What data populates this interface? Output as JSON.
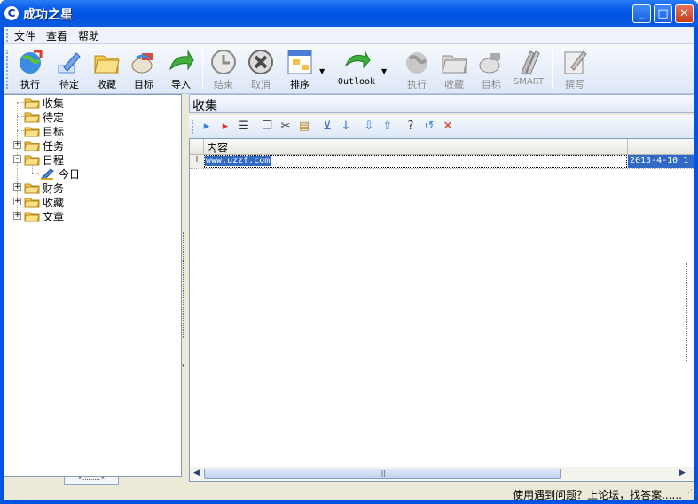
{
  "window": {
    "title": "成功之星",
    "icon_letter": "C",
    "minimize": "_",
    "maximize": "□",
    "close": "✕"
  },
  "menu": [
    "文件",
    "查看",
    "帮助"
  ],
  "toolbar": {
    "buttons": [
      {
        "label": "执行",
        "icon": "globe-run-icon",
        "enabled": true
      },
      {
        "label": "待定",
        "icon": "pencil-icon",
        "enabled": true
      },
      {
        "label": "收藏",
        "icon": "folder-icon",
        "enabled": true
      },
      {
        "label": "目标",
        "icon": "target-icon",
        "enabled": true
      },
      {
        "label": "导入",
        "icon": "import-arrow-icon",
        "enabled": true
      },
      {
        "label": "结束",
        "icon": "clock-icon",
        "enabled": false
      },
      {
        "label": "取消",
        "icon": "cancel-icon",
        "enabled": false
      },
      {
        "label": "排序",
        "icon": "sort-icon",
        "enabled": true
      },
      {
        "label": "Outlook",
        "icon": "outlook-icon",
        "enabled": true
      },
      {
        "label": "执行",
        "icon": "globe-run-icon",
        "enabled": false
      },
      {
        "label": "收藏",
        "icon": "folder-icon",
        "enabled": false
      },
      {
        "label": "目标",
        "icon": "target-icon",
        "enabled": false
      },
      {
        "label": "SMART",
        "icon": "smart-icon",
        "enabled": false
      },
      {
        "label": "撰写",
        "icon": "write-icon",
        "enabled": false
      }
    ]
  },
  "tree": {
    "items": [
      {
        "label": "收集",
        "level": 0,
        "expander": ""
      },
      {
        "label": "待定",
        "level": 0,
        "expander": ""
      },
      {
        "label": "目标",
        "level": 0,
        "expander": ""
      },
      {
        "label": "任务",
        "level": 0,
        "expander": "+"
      },
      {
        "label": "日程",
        "level": 0,
        "expander": "-"
      },
      {
        "label": "今日",
        "level": 1,
        "expander": ""
      },
      {
        "label": "财务",
        "level": 0,
        "expander": "+"
      },
      {
        "label": "收藏",
        "level": 0,
        "expander": "+"
      },
      {
        "label": "文章",
        "level": 0,
        "expander": "+"
      }
    ]
  },
  "right_panel": {
    "title": "收集",
    "grid": {
      "columns": [
        "内容",
        ""
      ],
      "rows": [
        {
          "content": "www.uzzf.com",
          "date": "2013-4-10 1"
        }
      ]
    }
  },
  "statusbar": {
    "text": "使用遇到问题？上论坛，找答案......"
  },
  "colors": {
    "title_blue": "#0054e3",
    "selection": "#316ac5",
    "folder_yellow": "#f5c94a"
  }
}
